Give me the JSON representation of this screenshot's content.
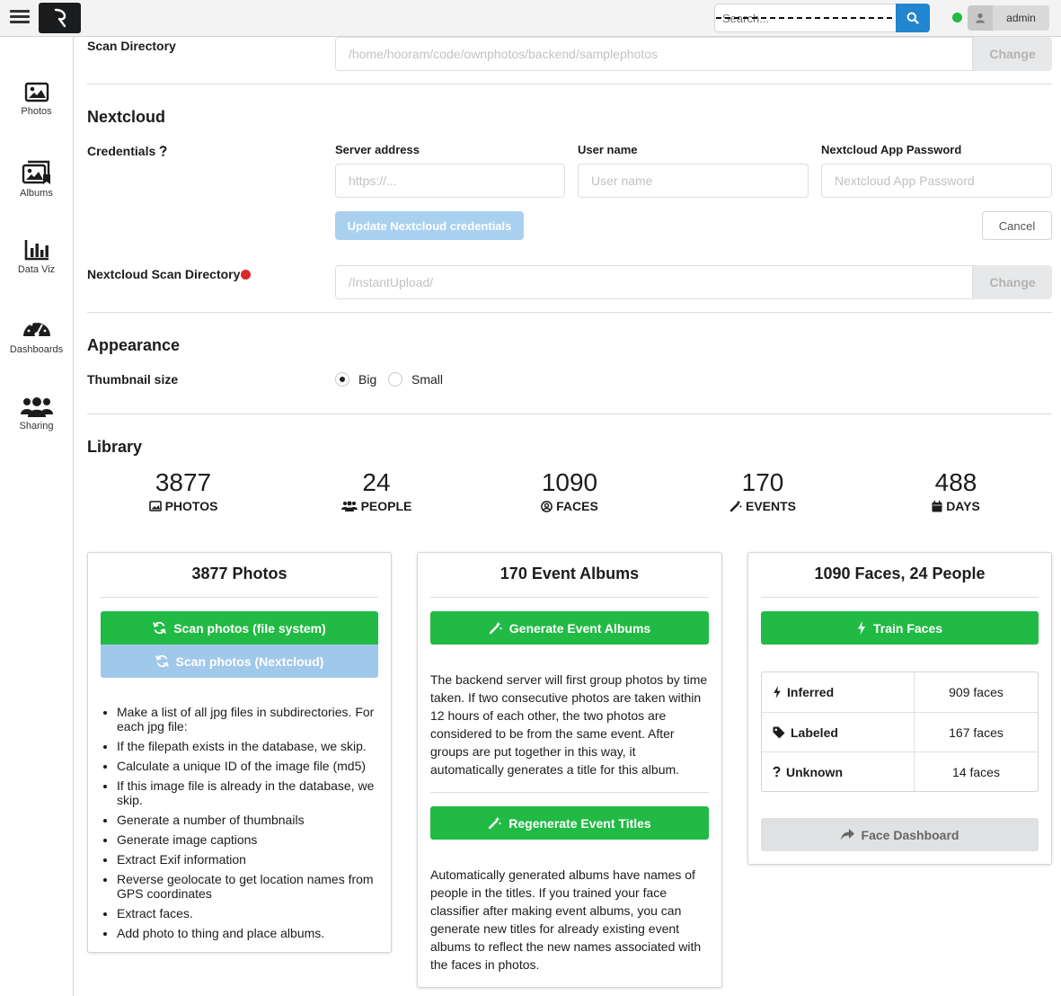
{
  "header": {
    "search_placeholder": "Search...",
    "user_name": "admin",
    "status_color": "#21ba45",
    "accent_color": "#2185d0"
  },
  "sidebar": {
    "items": [
      {
        "label": "Photos",
        "icon": "photo-icon"
      },
      {
        "label": "Albums",
        "icon": "albums-icon"
      },
      {
        "label": "Data Viz",
        "icon": "bar-chart-icon"
      },
      {
        "label": "Dashboards",
        "icon": "dashboard-icon"
      },
      {
        "label": "Sharing",
        "icon": "users-icon"
      }
    ]
  },
  "scan_directory": {
    "label": "Scan Directory",
    "value": "/home/hooram/code/ownphotos/backend/samplephotos",
    "button": "Change"
  },
  "nextcloud": {
    "title": "Nextcloud",
    "credentials_label": "Credentials",
    "server_label": "Server address",
    "server_placeholder": "https://...",
    "user_label": "User name",
    "user_placeholder": "User name",
    "password_label": "Nextcloud App Password",
    "password_placeholder": "Nextcloud App Password",
    "update_button": "Update Nextcloud credentials",
    "cancel_button": "Cancel",
    "scan_dir_label": "Nextcloud Scan Directory",
    "scan_dir_value": "/InstantUpload/",
    "change_button": "Change"
  },
  "appearance": {
    "title": "Appearance",
    "thumbnail_label": "Thumbnail size",
    "option_big": "Big",
    "option_small": "Small",
    "selected": "Big"
  },
  "library": {
    "title": "Library",
    "stats": [
      {
        "value": "3877",
        "label": "PHOTOS",
        "icon": "image-icon"
      },
      {
        "value": "24",
        "label": "PEOPLE",
        "icon": "users-icon"
      },
      {
        "value": "1090",
        "label": "FACES",
        "icon": "user-circle-icon"
      },
      {
        "value": "170",
        "label": "EVENTS",
        "icon": "magic-wand-icon"
      },
      {
        "value": "488",
        "label": "DAYS",
        "icon": "calendar-icon"
      }
    ]
  },
  "cards": {
    "photos": {
      "title": "3877 Photos",
      "scan_fs": "Scan photos (file system)",
      "scan_nc": "Scan photos (Nextcloud)",
      "steps": [
        "Make a list of all jpg files in subdirectories. For each jpg file:",
        "If the filepath exists in the database, we skip.",
        "Calculate a unique ID of the image file (md5)",
        "If this image file is already in the database, we skip.",
        "Generate a number of thumbnails",
        "Generate image captions",
        "Extract Exif information",
        "Reverse geolocate to get location names from GPS coordinates",
        "Extract faces.",
        "Add photo to thing and place albums."
      ]
    },
    "events": {
      "title": "170 Event Albums",
      "generate": "Generate Event Albums",
      "generate_desc": "The backend server will first group photos by time taken. If two consecutive photos are taken within 12 hours of each other, the two photos are considered to be from the same event. After groups are put together in this way, it automatically generates a title for this album.",
      "regenerate": "Regenerate Event Titles",
      "regenerate_desc": "Automatically generated albums have names of people in the titles. If you trained your face classifier after making event albums, you can generate new titles for already existing event albums to reflect the new names associated with the faces in photos."
    },
    "faces": {
      "title": "1090 Faces, 24 People",
      "train": "Train Faces",
      "rows": [
        {
          "label": "Inferred",
          "value": "909 faces",
          "icon": "bolt-icon"
        },
        {
          "label": "Labeled",
          "value": "167 faces",
          "icon": "tag-icon"
        },
        {
          "label": "Unknown",
          "value": "14 faces",
          "icon": "question-icon"
        }
      ],
      "dashboard": "Face Dashboard"
    }
  }
}
